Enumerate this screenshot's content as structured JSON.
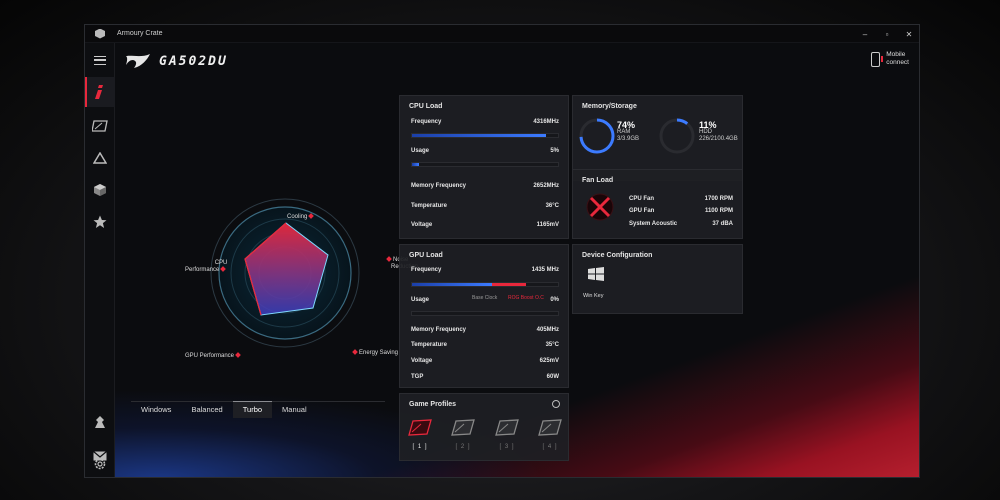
{
  "window": {
    "title": "Armoury Crate",
    "controls": [
      "–",
      "▫",
      "✕"
    ]
  },
  "header": {
    "model": "GA502DU",
    "mobile_connect": [
      "Mobile",
      "connect"
    ]
  },
  "sidebar": {
    "items": [
      {
        "icon": "menu-icon"
      },
      {
        "icon": "info-icon",
        "active": true
      },
      {
        "icon": "device-icon"
      },
      {
        "icon": "aura-icon"
      },
      {
        "icon": "cube-icon"
      },
      {
        "icon": "star-icon"
      },
      {
        "icon": "user-icon"
      },
      {
        "icon": "mail-icon"
      },
      {
        "icon": "settings-icon"
      }
    ]
  },
  "radar": {
    "labels": {
      "cooling": "Cooling",
      "noise": [
        "Noise",
        "Reduction"
      ],
      "energy": "Energy Saving",
      "gpu": "GPU Performance",
      "cpu": [
        "CPU",
        "Performance"
      ]
    }
  },
  "modes": {
    "tabs": [
      "Windows",
      "Balanced",
      "Turbo",
      "Manual"
    ],
    "active": "Turbo"
  },
  "cpu_load": {
    "title": "CPU Load",
    "frequency_label": "Frequency",
    "frequency_value": "4316MHz",
    "frequency_fraction": 0.92,
    "usage_label": "Usage",
    "usage_value": "5%",
    "usage_fraction": 0.05,
    "memory_frequency_label": "Memory Frequency",
    "memory_frequency_value": "2652MHz",
    "temperature_label": "Temperature",
    "temperature_value": "36°C",
    "voltage_label": "Voltage",
    "voltage_value": "1165mV"
  },
  "gpu_load": {
    "title": "GPU Load",
    "frequency_label": "Frequency",
    "frequency_value": "1435 MHz",
    "frequency_fraction": 0.78,
    "base_clock_label": "Base Clock",
    "boost_label": "ROG Boost O.C",
    "usage_label": "Usage",
    "usage_value": "0%",
    "usage_fraction": 0.0,
    "memory_frequency_label": "Memory Frequency",
    "memory_frequency_value": "405MHz",
    "temperature_label": "Temperature",
    "temperature_value": "35°C",
    "voltage_label": "Voltage",
    "voltage_value": "625mV",
    "tgp_label": "TGP",
    "tgp_value": "60W"
  },
  "memory": {
    "title": "Memory/Storage",
    "ram_percent": "74%",
    "ram_label": "RAM",
    "ram_detail": "3/3.9GB",
    "ram_fraction": 0.74,
    "hdd_percent": "11%",
    "hdd_label": "HDD",
    "hdd_detail": "226/2100.4GB",
    "hdd_fraction": 0.11
  },
  "fan": {
    "title": "Fan Load",
    "cpu_fan_label": "CPU Fan",
    "cpu_fan_value": "1700  RPM",
    "gpu_fan_label": "GPU Fan",
    "gpu_fan_value": "1100  RPM",
    "acoustic_label": "System Acoustic",
    "acoustic_value": "37 dBA"
  },
  "device": {
    "title": "Device Configuration",
    "winkey_label": "Win Key"
  },
  "profiles": {
    "title": "Game Profiles",
    "items": [
      "[ 1 ]",
      "[ 2 ]",
      "[ 3 ]",
      "[ 4 ]"
    ],
    "active_index": 0
  },
  "colors": {
    "accent_red": "#e8283c",
    "accent_blue": "#3c7bff"
  }
}
